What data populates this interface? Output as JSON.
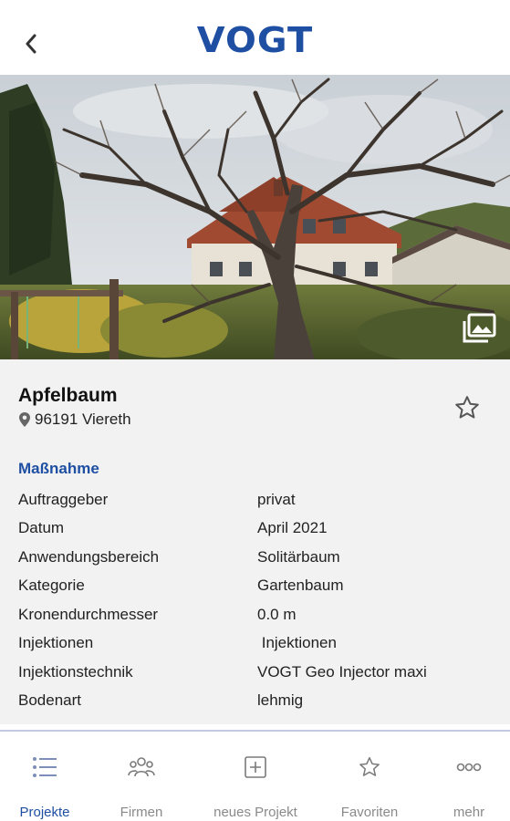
{
  "header": {
    "logo_text": "VOGT",
    "back_icon": "chevron-left-icon"
  },
  "hero": {
    "gallery_icon": "image-gallery-icon"
  },
  "project": {
    "title": "Apfelbaum",
    "location": "96191 Viereth",
    "location_icon": "map-pin-icon",
    "favorite_icon": "star-outline-icon"
  },
  "section": {
    "heading": "Maßnahme",
    "rows": [
      {
        "label": "Auftraggeber",
        "value": "privat"
      },
      {
        "label": "Datum",
        "value": "April 2021"
      },
      {
        "label": "Anwendungsbereich",
        "value": "Solitärbaum"
      },
      {
        "label": "Kategorie",
        "value": "Gartenbaum"
      },
      {
        "label": "Kronendurchmesser",
        "value": "0.0 m"
      },
      {
        "label": "Injektionen",
        "value": " Injektionen"
      },
      {
        "label": "Injektionstechnik",
        "value": "VOGT Geo Injector maxi"
      },
      {
        "label": "Bodenart",
        "value": "lehmig"
      }
    ]
  },
  "nav": {
    "items": [
      {
        "label": "Projekte",
        "icon": "list-icon",
        "active": true
      },
      {
        "label": "Firmen",
        "icon": "people-icon",
        "active": false
      },
      {
        "label": "neues Projekt",
        "icon": "add-square-icon",
        "active": false
      },
      {
        "label": "Favoriten",
        "icon": "star-icon",
        "active": false
      },
      {
        "label": "mehr",
        "icon": "more-icon",
        "active": false
      }
    ]
  },
  "colors": {
    "brand": "#1f4fa3",
    "panel_bg": "#f2f2f2",
    "nav_inactive": "#8a8a8a",
    "nav_border": "#c3c8e3"
  }
}
